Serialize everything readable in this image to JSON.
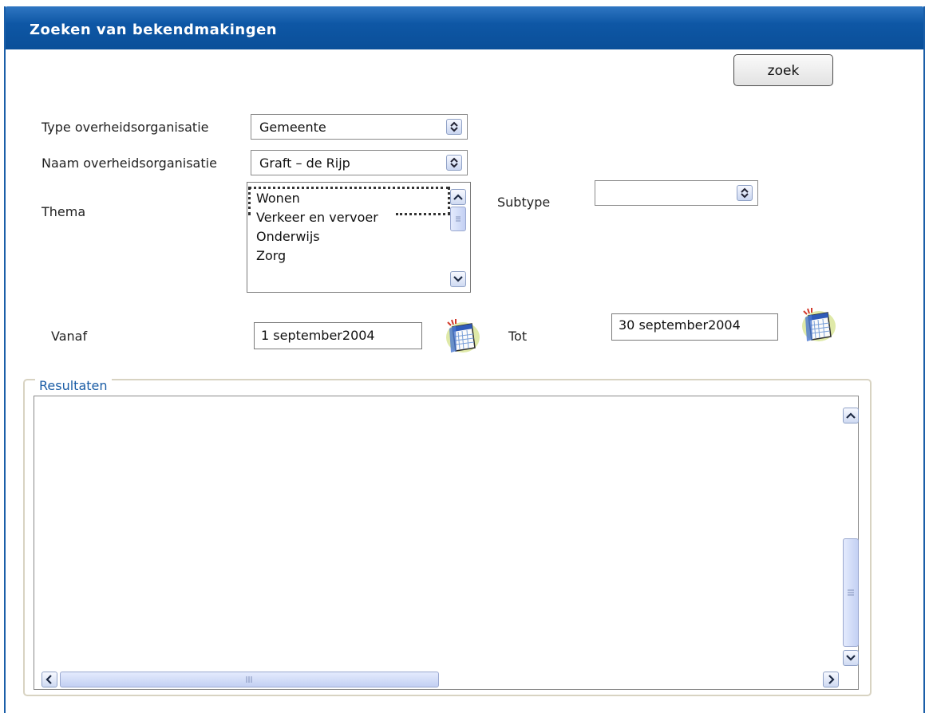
{
  "window": {
    "title": "Zoeken van bekendmakingen"
  },
  "search_button": {
    "label": "zoek"
  },
  "form": {
    "type_label": "Type overheidsorganisatie",
    "type_value": "Gemeente",
    "naam_label": "Naam overheidsorganisatie",
    "naam_value": "Graft – de Rijp",
    "thema_label": "Thema",
    "thema_items": [
      "Wonen",
      "Verkeer en vervoer",
      "Onderwijs",
      "Zorg"
    ],
    "thema_selected": "Wonen",
    "subtype_label": "Subtype",
    "subtype_value": "",
    "vanaf_label": "Vanaf",
    "vanaf_value": "1 september2004",
    "tot_label": "Tot",
    "tot_value": "30 september2004"
  },
  "results": {
    "legend": "Resultaten"
  },
  "icons": {
    "calendar": "calendar-icon",
    "spinner": "up-down-arrows-icon",
    "scroll_up": "chevron-up-icon",
    "scroll_down": "chevron-down-icon",
    "scroll_left": "chevron-left-icon",
    "scroll_right": "chevron-right-icon"
  },
  "colors": {
    "titlebar": "#0e57a5",
    "legend_text": "#1b5da6",
    "scrollbar": "#c9d5f0"
  }
}
